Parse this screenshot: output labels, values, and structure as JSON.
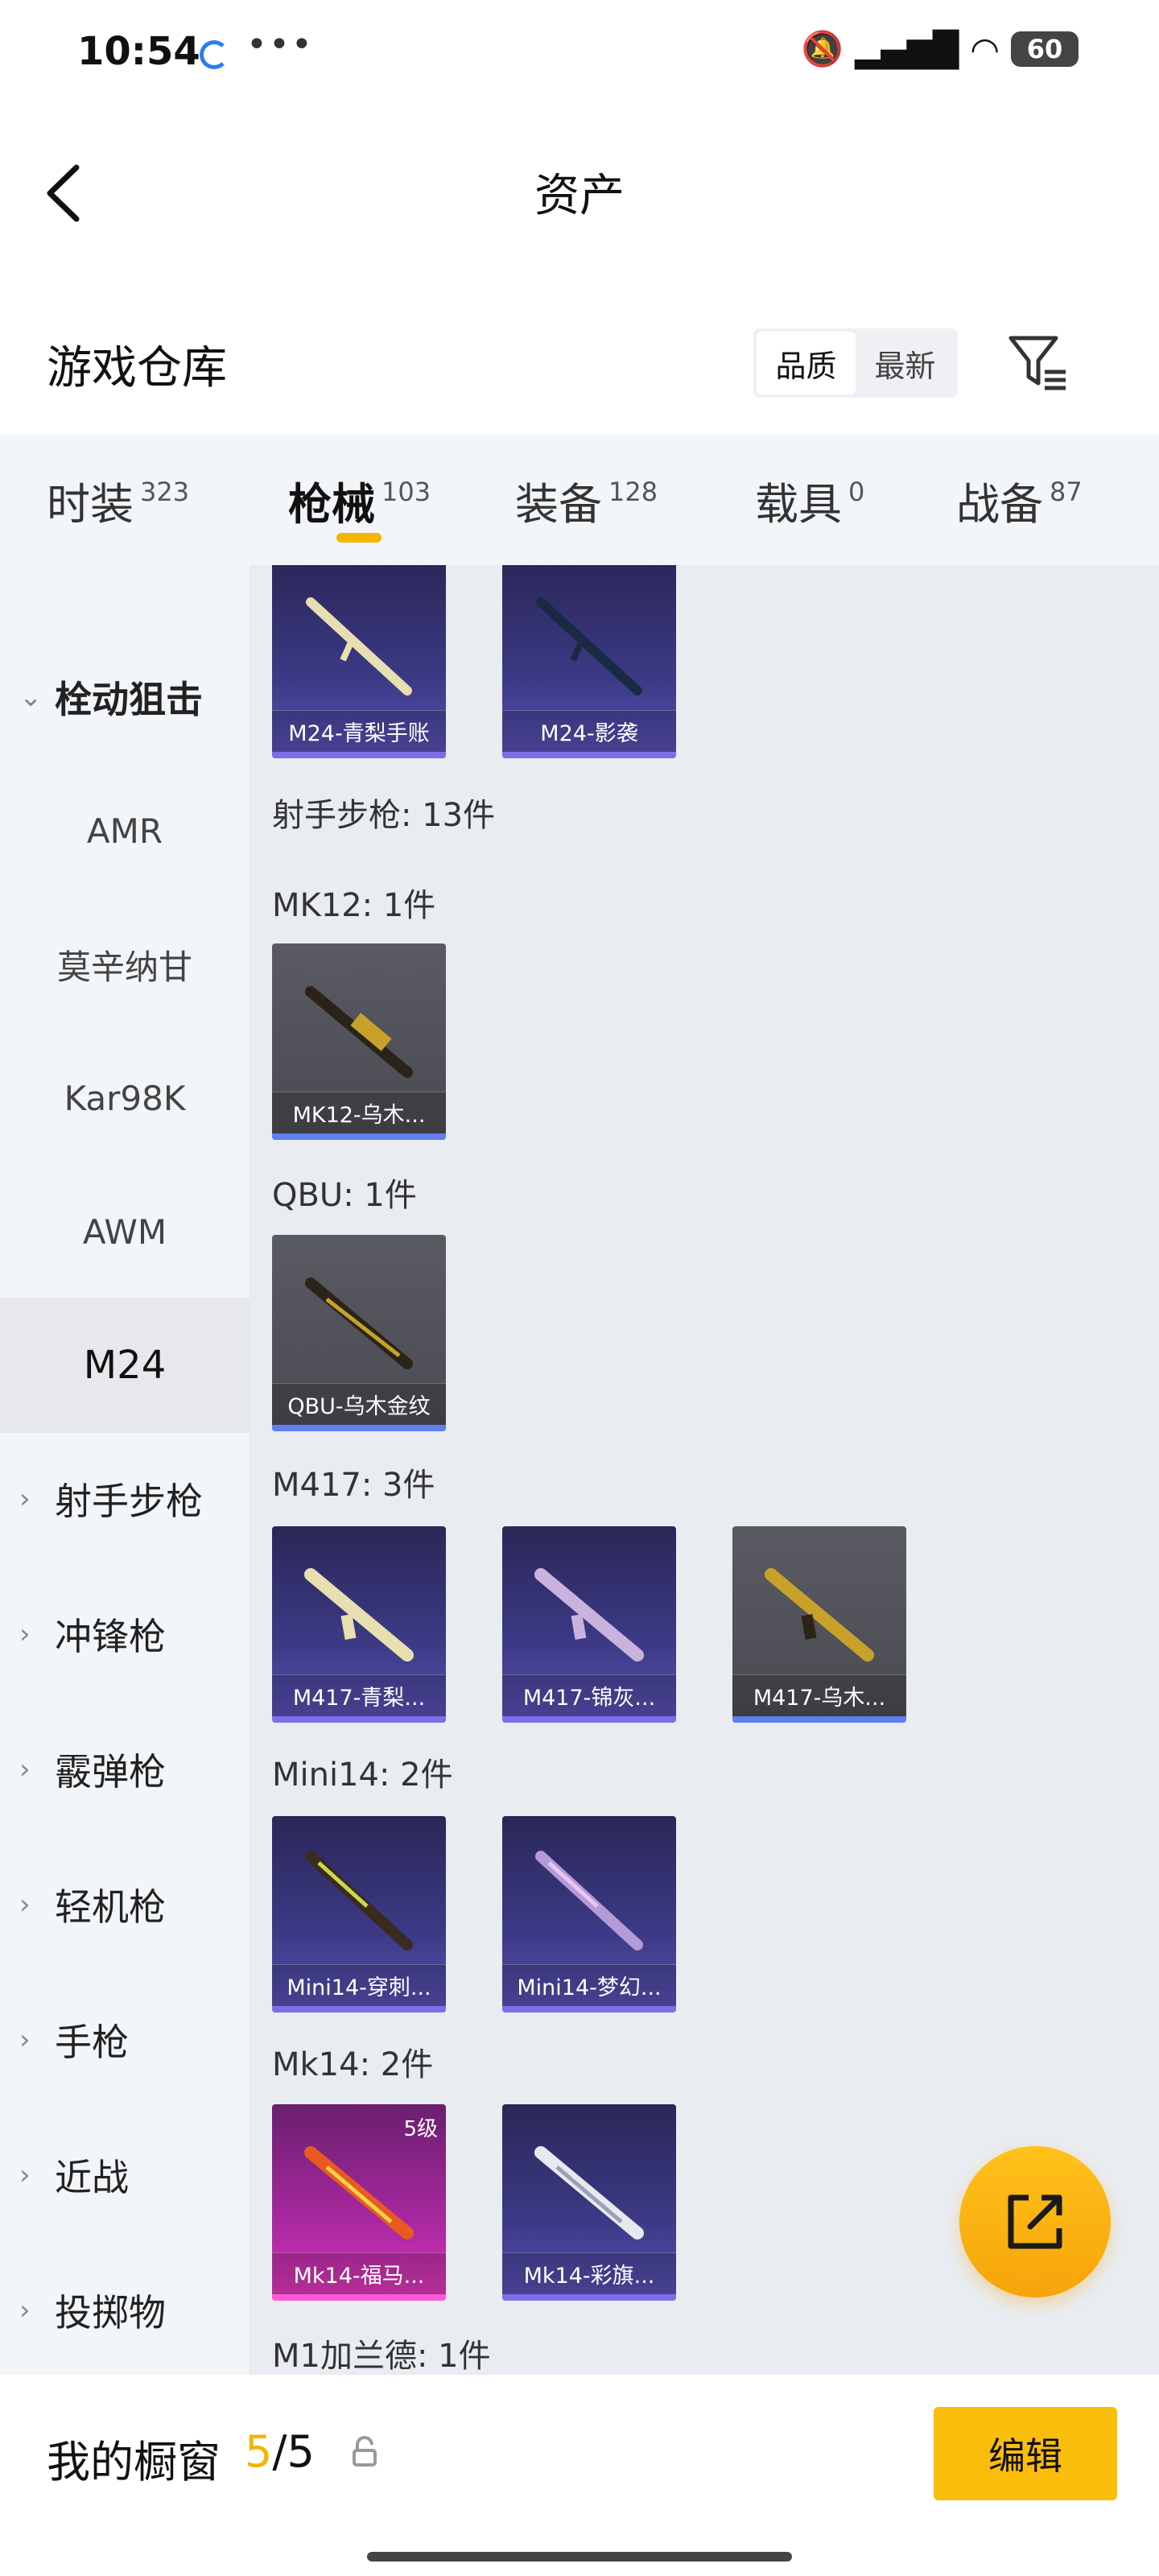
{
  "status": {
    "time": "10:54",
    "battery": "60"
  },
  "header": {
    "title": "资产"
  },
  "warehouse": {
    "title": "游戏仓库",
    "sort_quality": "品质",
    "sort_newest": "最新"
  },
  "tabs": [
    {
      "label": "时装",
      "count": "323"
    },
    {
      "label": "枪械",
      "count": "103"
    },
    {
      "label": "装备",
      "count": "128"
    },
    {
      "label": "载具",
      "count": "0"
    },
    {
      "label": "战备",
      "count": "87"
    }
  ],
  "nav": {
    "group_open": "栓动狙击",
    "sub": [
      "AMR",
      "莫辛纳甘",
      "Kar98K",
      "AWM",
      "M24"
    ],
    "groups": [
      "射手步枪",
      "冲锋枪",
      "霰弹枪",
      "轻机枪",
      "手枪",
      "近战",
      "投掷物"
    ]
  },
  "content": {
    "sections": [
      "射手步枪: 13件",
      "MK12: 1件",
      "QBU: 1件",
      "M417: 3件",
      "Mini14: 2件",
      "Mk14: 2件",
      "M1加兰德: 1件"
    ],
    "items": {
      "m24_1": "M24-青梨手账",
      "m24_2": "M24-影袭",
      "mk12_1": "MK12-乌木...",
      "qbu_1": "QBU-乌木金纹",
      "m417_1": "M417-青梨...",
      "m417_2": "M417-锦灰...",
      "m417_3": "M417-乌木...",
      "mini14_1": "Mini14-穿刺...",
      "mini14_2": "Mini14-梦幻...",
      "mk14_1": "Mk14-福马...",
      "mk14_2": "Mk14-彩旗...",
      "mk14_1_level": "5级"
    }
  },
  "bottom": {
    "title": "我的橱窗",
    "current": "5",
    "total": "/5",
    "edit": "编辑"
  },
  "colors": {
    "accent": "#f5b400",
    "purple_rarity": "#7b6fe8",
    "pink_rarity": "#ff5ad6"
  }
}
